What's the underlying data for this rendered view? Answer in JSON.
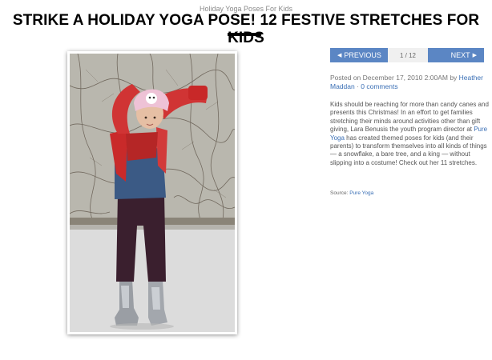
{
  "header": {
    "kicker": "Holiday Yoga Poses For Kids",
    "title": "STRIKE A HOLIDAY YOGA POSE! 12 FESTIVE STRETCHES FOR KIDS"
  },
  "pager": {
    "prev_label": "PREVIOUS",
    "count": "1 / 12",
    "next_label": "NEXT",
    "prev_arrow": "◀",
    "next_arrow": "▶"
  },
  "meta": {
    "posted_prefix": "Posted on December 17, 2010 2:00AM by ",
    "author": "Heather Maddan",
    "separator": " · ",
    "comments": "0 comments"
  },
  "body": {
    "part1": "Kids should be reaching for more than candy canes and presents this Christmas! In an effort to get families stretching their minds around activities other than gift giving, Lara Benusis the youth program director at ",
    "link": "Pure Yoga",
    "part2": " has created themed poses for kids (and their parents) to transform themselves into all kinds of things — a snowflake, a bare tree, and a king — without slipping into a costume! Check out her 11 stretches."
  },
  "source": {
    "label": "Source: ",
    "link": "Pure Yoga"
  },
  "colors": {
    "accent": "#5b86c4",
    "link": "#3a6fb5"
  }
}
